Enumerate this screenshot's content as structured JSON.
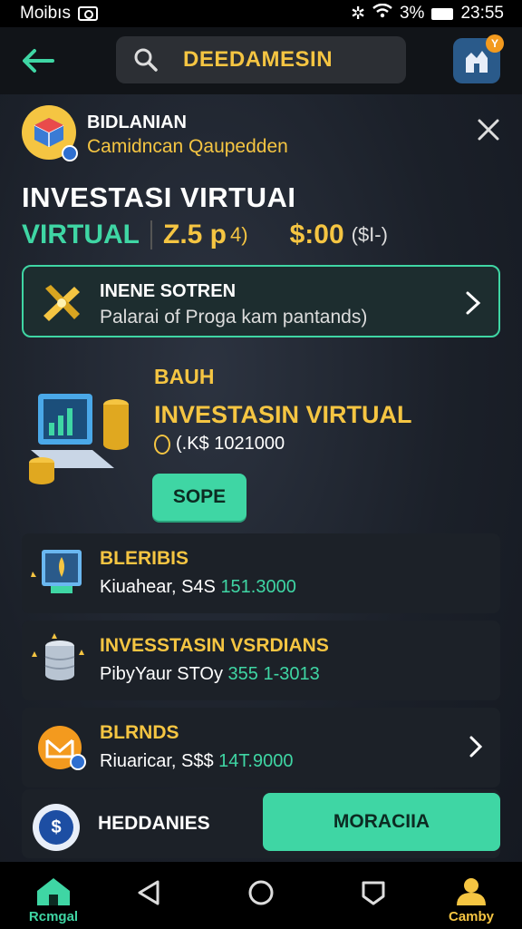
{
  "status_bar": {
    "carrier": "Moibıs",
    "battery": "3%",
    "time": "23:55"
  },
  "topbar": {
    "search_text": "DEEDAMESIN",
    "app_badge": "Y"
  },
  "profile": {
    "name": "BIDLANIAN",
    "subtitle": "Camidncan Qaupedden"
  },
  "main_title": "INVESTASI VIRTUAI",
  "stats": {
    "virtual_label": "VIRTUAL",
    "rate": "Z.5 p",
    "rate_unit": "4)",
    "money": "$:00",
    "currency": "($I-)"
  },
  "promo": {
    "title": "INENE SOTREN",
    "subtitle": "Palarai of Proga  kam pantands)"
  },
  "feature": {
    "small_label": "BAUH",
    "title": "INVESTASIN VIRTUAL",
    "value": "(.K$ 1021000",
    "button": "SOPE"
  },
  "list": [
    {
      "title": "BLERIBIS",
      "sub": "Kiuahear, S4S ",
      "num": "151.3000"
    },
    {
      "title": "INVESSTASIN VSRDIANS",
      "sub": "PibyYaur STOy ",
      "num": "355 1-3013"
    },
    {
      "title": "BLRNDS",
      "sub": "Riuaricar, S$$ ",
      "num": "14T.9000"
    }
  ],
  "bottom": {
    "label": "HEDDANIES",
    "icon_text": "$",
    "button": "MORACIIA"
  },
  "navbar": {
    "home_label": "Rcmgal",
    "profile_label": "Camby"
  },
  "colors": {
    "accent_green": "#3fd6a4",
    "accent_gold": "#f5c542",
    "background": "#1b2029"
  },
  "icons": [
    "back-arrow-icon",
    "search-icon",
    "close-icon",
    "chevron-right-icon",
    "triangle-back-icon",
    "circle-home-icon",
    "square-recents-icon"
  ]
}
